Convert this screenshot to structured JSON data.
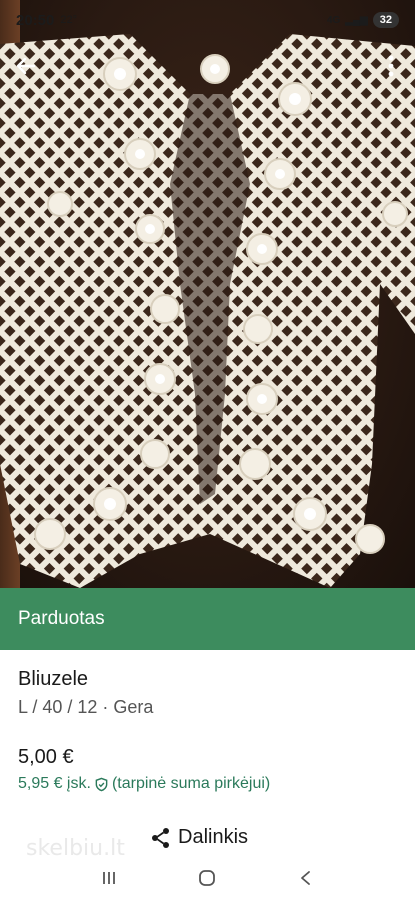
{
  "status_bar": {
    "time": "20:50",
    "temperature": "22°",
    "network": "4G",
    "battery": "32"
  },
  "listing": {
    "status": "Parduotas",
    "title": "Bliuzele",
    "details": "L / 40 / 12 · Gera",
    "price": "5,00 €",
    "buyer_price": "5,95 € įsk.",
    "buyer_price_note": "(tarpinė suma pirkėjui)"
  },
  "actions": {
    "share_label": "Dalinkis"
  },
  "watermark": "skelbiu.lt",
  "colors": {
    "sold_banner": "#3d8c5e",
    "buyer_price": "#2b7a5b"
  },
  "icons": {
    "back": "arrow-left-icon",
    "more": "more-vertical-icon",
    "shield": "shield-check-icon",
    "share": "share-icon",
    "nav_recent": "recent-apps-icon",
    "nav_home": "home-icon",
    "nav_back": "nav-back-icon"
  }
}
